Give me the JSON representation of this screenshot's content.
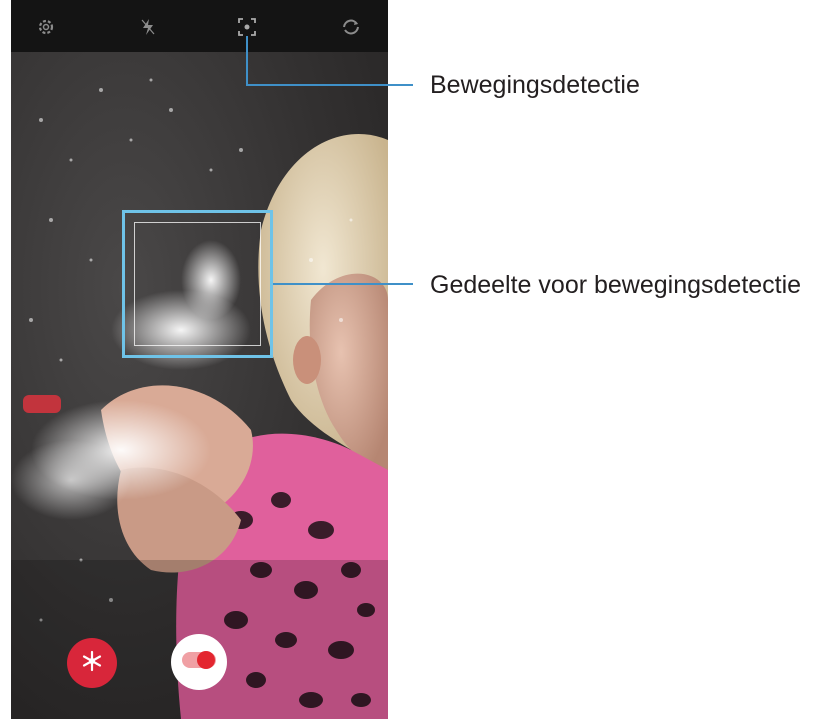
{
  "callouts": {
    "motion_detection": "Bewegingsdetectie",
    "motion_detection_area": "Gedeelte voor bewegingsdetectie"
  },
  "camera": {
    "top_icons": [
      "settings-icon",
      "flash-off-icon",
      "motion-detection-icon",
      "switch-camera-icon"
    ],
    "hint_text": "",
    "effect_icon": "snowflake-icon",
    "record_icon": "record-toggle-icon"
  },
  "colors": {
    "accent": "#3f90c8",
    "focus_frame": "#6fc3e8",
    "effect_button": "#d8263a",
    "record_dot": "#e3262f"
  }
}
